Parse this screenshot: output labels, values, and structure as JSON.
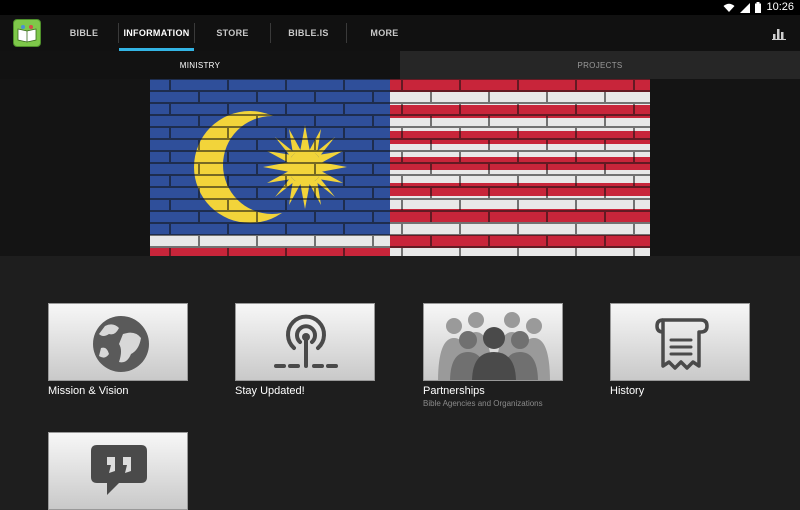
{
  "status_bar": {
    "time": "10:26"
  },
  "action_bar": {
    "tabs": [
      {
        "label": "BIBLE",
        "active": false
      },
      {
        "label": "INFORMATION",
        "active": true
      },
      {
        "label": "STORE",
        "active": false
      },
      {
        "label": "BIBLE.IS",
        "active": false
      },
      {
        "label": "MORE",
        "active": false
      }
    ]
  },
  "sub_tabs": [
    {
      "label": "MINISTRY",
      "active": true
    },
    {
      "label": "PROJECTS",
      "active": false
    }
  ],
  "hero": {
    "image": "malaysia-flag-painted-on-brick-wall"
  },
  "cards": [
    {
      "title": "Mission & Vision",
      "subtitle": "",
      "icon": "globe-icon"
    },
    {
      "title": "Stay Updated!",
      "subtitle": "",
      "icon": "broadcast-icon"
    },
    {
      "title": "Partnerships",
      "subtitle": "Bible Agencies and Organizations",
      "icon": "people-group-icon"
    },
    {
      "title": "History",
      "subtitle": "",
      "icon": "scroll-icon"
    },
    {
      "title": "",
      "subtitle": "",
      "icon": "quote-bubble-icon"
    }
  ],
  "colors": {
    "accent": "#33b5e5",
    "background": "#1e1e1e",
    "action_bar": "#111111"
  }
}
